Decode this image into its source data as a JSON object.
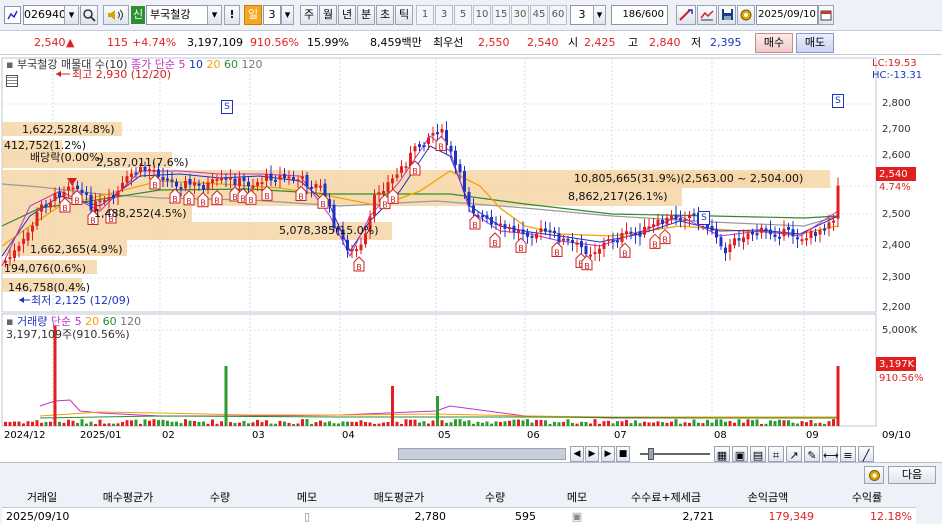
{
  "toolbar": {
    "stock_code": "026940",
    "market_badge": "신",
    "stock_name": "부국철강",
    "alert_label": "!",
    "period_day": "일",
    "period_count": "3",
    "period_week": "주",
    "period_month": "월",
    "period_year": "년",
    "period_minute": "분",
    "period_second": "초",
    "period_tick": "틱",
    "intervals": [
      "1",
      "3",
      "5",
      "10",
      "15",
      "30",
      "45",
      "60"
    ],
    "interval_value": "3",
    "bar_count": "186",
    "bar_total": "/600",
    "date": "2025/09/10"
  },
  "quote": {
    "price": "2,540",
    "change_arrow": "▲",
    "change": "115",
    "change_pct": "+4.74%",
    "volume": "3,197,109",
    "volume_ratio": "910.56%",
    "turnover": "15.99%",
    "amount": "8,459백만",
    "best_ask_label": "최우선",
    "best_ask": "2,550",
    "best_bid": "2,540",
    "open_label": "시",
    "open": "2,425",
    "high_label": "고",
    "high": "2,840",
    "low_label": "저",
    "low": "2,395",
    "buy_label": "매수",
    "sell_label": "매도"
  },
  "price_panel": {
    "legend_name": "부국철강",
    "legend_trade": "매물대",
    "legend_count": "수(10)",
    "legend_ma": "종가 단순",
    "ma_periods": [
      "5",
      "10",
      "20",
      "60",
      "120"
    ],
    "high_note": "최고 2,930 (12/20)",
    "low_note": "최저 2,125 (12/09)",
    "lc": "LC:19.53",
    "hc": "HC:-13.31",
    "price_tag": "2,540",
    "pct_tag": "4.74%",
    "dividend_note": "배당락(0.00%)",
    "axis_labels": [
      "2,800",
      "2,700",
      "2,600",
      "2,500",
      "2,400",
      "2,300",
      "2,200"
    ],
    "annotations": [
      "1,622,528(4.8%)",
      "412,752(1.2%)",
      "2,587,011(7.6%)",
      "10,805,665(31.9%)(2,563.00 ~ 2,504.00)",
      "8,862,217(26.1%)",
      "1,488,252(4.5%)",
      "5,078,385(15.0%)",
      "1,662,365(4.9%)",
      "194,076(0.6%)",
      "146,758(0.4%)"
    ]
  },
  "volume_panel": {
    "legend_name": "거래량",
    "legend_ma": "단순",
    "ma_periods": [
      "5",
      "20",
      "60",
      "120"
    ],
    "value_note": "3,197,109주(910.56%)",
    "axis_label": "5,000K",
    "volume_tag": "3,197K",
    "pct_tag": "910.56%"
  },
  "months": [
    "2024/12",
    "2025/01",
    "02",
    "03",
    "04",
    "05",
    "06",
    "07",
    "08",
    "09"
  ],
  "month_end": "09/10",
  "bottom": {
    "next_button": "다음",
    "columns": [
      "거래일",
      "매수평균가",
      "수량",
      "메모",
      "매도평균가",
      "수량",
      "메모",
      "수수료+제세금",
      "손익금액",
      "수익률"
    ],
    "row": [
      "2025/09/10",
      "",
      "",
      "",
      "2,780",
      "595",
      "",
      "2,721",
      "179,349",
      "12.18%"
    ]
  },
  "colors": {
    "up": "#e21f1f",
    "down": "#1c33c4",
    "volume_profile": "#f6d7a6",
    "toolbar_bg": "#eef1f7"
  },
  "icons": [
    "search-icon",
    "speaker-icon",
    "chart-icon",
    "save-icon",
    "settings-icon"
  ]
}
